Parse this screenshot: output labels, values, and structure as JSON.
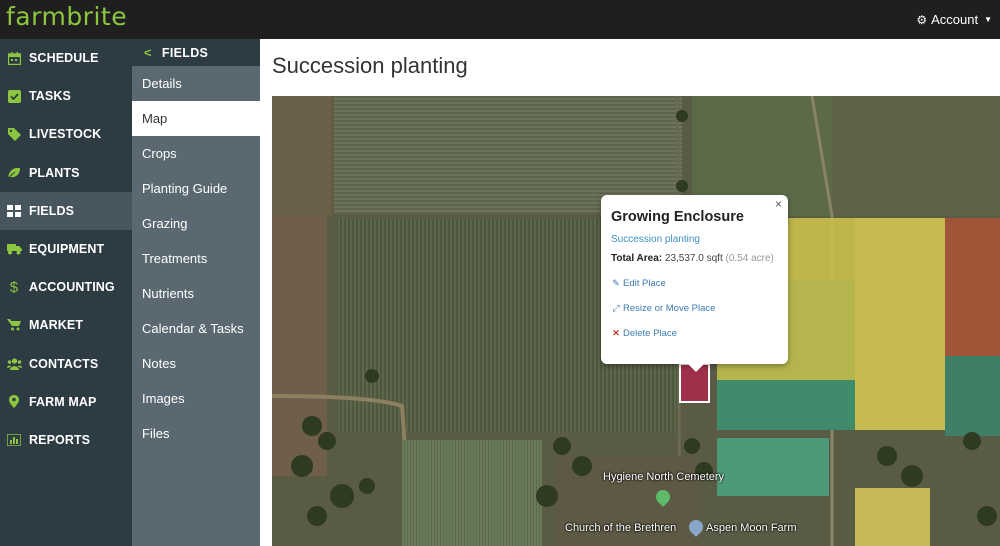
{
  "brand": {
    "logo": "farmbrite",
    "accent": "#8cc63f"
  },
  "header": {
    "account_label": "Account",
    "account_icon": "gear-icon"
  },
  "nav": {
    "items": [
      {
        "label": "SCHEDULE",
        "icon": "calendar-icon"
      },
      {
        "label": "TASKS",
        "icon": "checkbox-icon"
      },
      {
        "label": "LIVESTOCK",
        "icon": "tag-icon"
      },
      {
        "label": "PLANTS",
        "icon": "leaf-icon"
      },
      {
        "label": "FIELDS",
        "icon": "grid-icon"
      },
      {
        "label": "EQUIPMENT",
        "icon": "truck-icon"
      },
      {
        "label": "ACCOUNTING",
        "icon": "dollar-icon"
      },
      {
        "label": "MARKET",
        "icon": "cart-icon"
      },
      {
        "label": "CONTACTS",
        "icon": "users-icon"
      },
      {
        "label": "FARM MAP",
        "icon": "map-marker-icon"
      },
      {
        "label": "REPORTS",
        "icon": "bar-chart-icon"
      }
    ],
    "active": "FIELDS"
  },
  "subnav": {
    "header": "FIELDS",
    "items": [
      "Details",
      "Map",
      "Crops",
      "Planting Guide",
      "Grazing",
      "Treatments",
      "Nutrients",
      "Calendar & Tasks",
      "Notes",
      "Images",
      "Files"
    ],
    "active": "Map"
  },
  "main": {
    "title": "Succession planting"
  },
  "popup": {
    "close": "×",
    "title": "Growing Enclosure",
    "subtitle": "Succession planting",
    "area_label": "Total Area:",
    "area_value": "23,537.0 sqft",
    "area_alt": "(0.54 acre)",
    "links": [
      {
        "label": "Edit Place",
        "icon": "pencil-icon"
      },
      {
        "label": "Resize or Move Place",
        "icon": "resize-icon"
      },
      {
        "label": "Delete Place",
        "icon": "delete-icon"
      }
    ]
  },
  "map_labels": {
    "cemetery": "Hygiene North Cemetery",
    "church": "Church of the Brethren",
    "farm": "Aspen Moon Farm"
  }
}
